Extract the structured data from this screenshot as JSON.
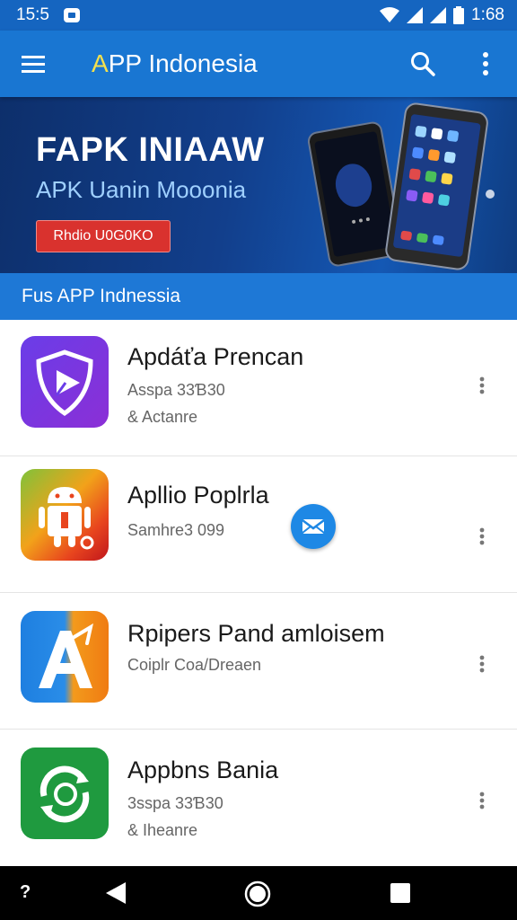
{
  "status_bar": {
    "time_left": "15:5",
    "time_right": "1:68"
  },
  "app_bar": {
    "title_first": "A",
    "title_rest": "PP Indonesia"
  },
  "banner": {
    "title": "FAPK INIAAW",
    "subtitle": "APK Uanin Mooonia",
    "button_label": "Rhdio U0G0KO"
  },
  "section": {
    "header": "Fus APP Indnessia"
  },
  "apps": [
    {
      "name": "Apdáťa Prencan",
      "meta1": "Asspa 33Ɓ30",
      "meta2": "& Actanre",
      "icon": "shield-play-icon"
    },
    {
      "name": "Apllio Poplrla",
      "meta1": "Samhre3 099",
      "meta2": "",
      "icon": "android-icon"
    },
    {
      "name": "Rpipers Pand amloisem",
      "meta1": "Coiplr Coa/Dreaen",
      "meta2": "",
      "icon": "letter-a-icon"
    },
    {
      "name": "Appbns Bania",
      "meta1": "3sspa 33Ɓ30",
      "meta2": "& Iheanre",
      "icon": "chat-refresh-icon"
    }
  ],
  "nav": {
    "extra_glyph": "?"
  },
  "colors": {
    "primary": "#1976d2",
    "status": "#1565c0",
    "accent_red": "#d9322e",
    "title_accent": "#f4e04d"
  }
}
